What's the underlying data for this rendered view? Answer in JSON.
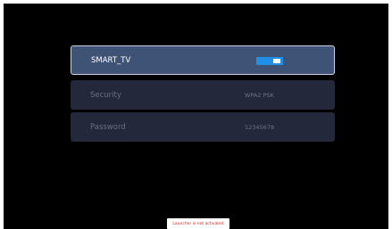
{
  "network": {
    "ssid": "SMART_TV",
    "toggle_state": "on"
  },
  "security": {
    "label": "Security",
    "value": "WPA2 PSK"
  },
  "password": {
    "label": "Password",
    "value": "12345678"
  },
  "status": {
    "message": "Launcher is not activated"
  },
  "colors": {
    "background": "#000000",
    "selected_row": "#3f5377",
    "row": "#23283a",
    "toggle": "#1f90e6",
    "status_text": "#d62020"
  }
}
